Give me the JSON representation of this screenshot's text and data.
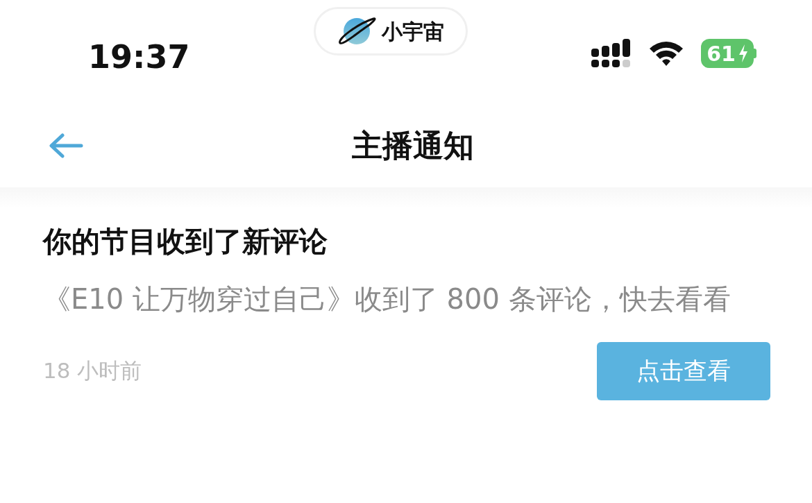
{
  "status_bar": {
    "time": "19:37",
    "app_name": "小宇宙",
    "battery": "61"
  },
  "header": {
    "title": "主播通知"
  },
  "notification": {
    "title": "你的节目收到了新评论",
    "body": "《E10 让万物穿过自己》收到了 800 条评论，快去看看",
    "time": "18 小时前",
    "action": "点击查看"
  }
}
